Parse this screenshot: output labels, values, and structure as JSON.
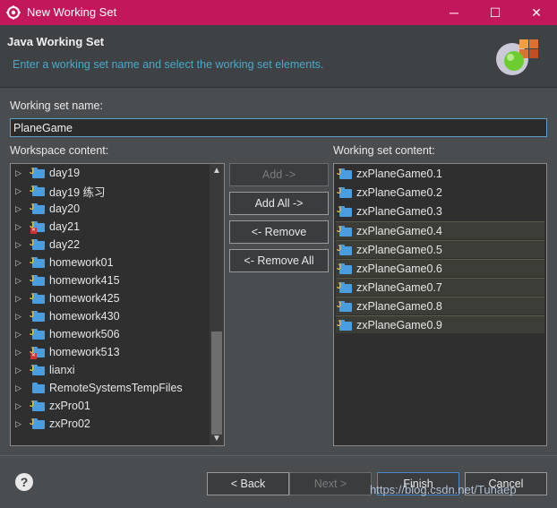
{
  "window": {
    "title": "New Working Set",
    "controls": [
      "─",
      "☐",
      "✕"
    ]
  },
  "banner": {
    "title": "Java Working Set",
    "description": "Enter a working set name and select the working set elements."
  },
  "name": {
    "label": "Working set name:",
    "value": "PlaneGame"
  },
  "workspace": {
    "label": "Workspace content:",
    "items": [
      {
        "label": "day19",
        "error": false,
        "type": "java"
      },
      {
        "label": "day19 练习",
        "error": false,
        "type": "java"
      },
      {
        "label": "day20",
        "error": false,
        "type": "java"
      },
      {
        "label": "day21",
        "error": true,
        "type": "java"
      },
      {
        "label": "day22",
        "error": false,
        "type": "java"
      },
      {
        "label": "homework01",
        "error": false,
        "type": "java"
      },
      {
        "label": "homework415",
        "error": false,
        "type": "java"
      },
      {
        "label": "homework425",
        "error": false,
        "type": "java"
      },
      {
        "label": "homework430",
        "error": false,
        "type": "java"
      },
      {
        "label": "homework506",
        "error": false,
        "type": "java"
      },
      {
        "label": "homework513",
        "error": true,
        "type": "java"
      },
      {
        "label": "lianxi",
        "error": false,
        "type": "java"
      },
      {
        "label": "RemoteSystemsTempFiles",
        "error": false,
        "type": "plain"
      },
      {
        "label": "zxPro01",
        "error": false,
        "type": "java"
      },
      {
        "label": "zxPro02",
        "error": false,
        "type": "java"
      }
    ],
    "scroll_fraction": 0.6
  },
  "set_content": {
    "label": "Working set content:",
    "items": [
      {
        "label": "zxPlaneGame0.1",
        "selected": false
      },
      {
        "label": "zxPlaneGame0.2",
        "selected": false
      },
      {
        "label": "zxPlaneGame0.3",
        "selected": false
      },
      {
        "label": "zxPlaneGame0.4",
        "selected": true
      },
      {
        "label": "zxPlaneGame0.5",
        "selected": true
      },
      {
        "label": "zxPlaneGame0.6",
        "selected": true
      },
      {
        "label": "zxPlaneGame0.7",
        "selected": true
      },
      {
        "label": "zxPlaneGame0.8",
        "selected": true
      },
      {
        "label": "zxPlaneGame0.9",
        "selected": true
      }
    ]
  },
  "buttons": {
    "add": "Add ->",
    "add_all": "Add All ->",
    "remove": "<- Remove",
    "remove_all": "<- Remove All",
    "back": "< Back",
    "next": "Next >",
    "finish": "Finish",
    "cancel": "Cancel",
    "help": "?"
  },
  "watermark": "https://blog.csdn.net/Tunaep",
  "colors": {
    "titlebar": "#c2185b",
    "banner_desc": "#4aa8c8",
    "body_bg": "#4a4d50"
  }
}
